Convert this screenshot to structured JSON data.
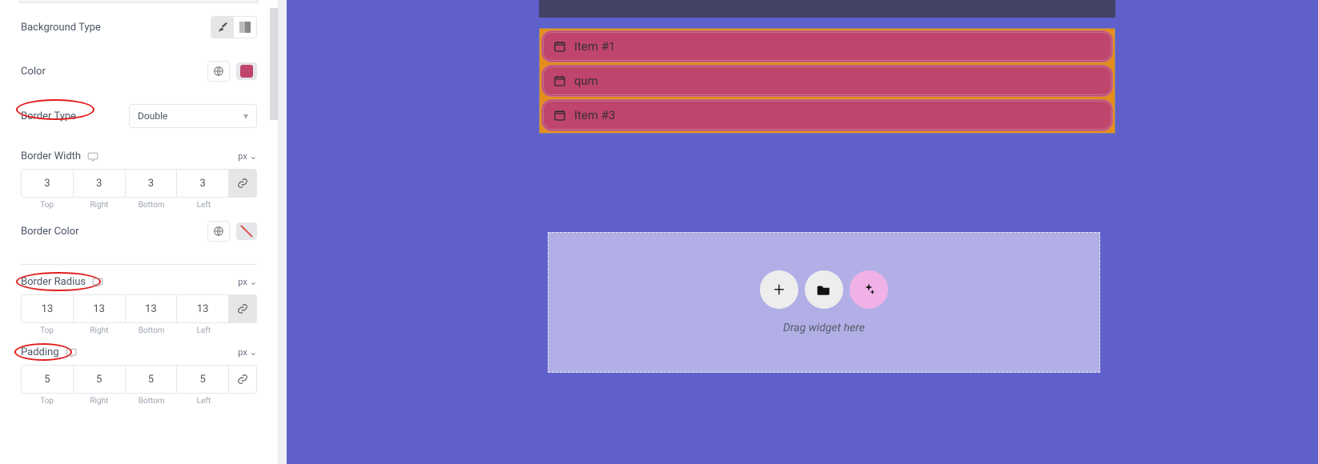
{
  "panel": {
    "background_type_label": "Background Type",
    "color_label": "Color",
    "color_swatch": "#c0456d",
    "border_type_label": "Border Type",
    "border_type_value": "Double",
    "border_width_label": "Border Width",
    "border_width_unit": "px",
    "border_width": {
      "top": "3",
      "right": "3",
      "bottom": "3",
      "left": "3"
    },
    "border_color_label": "Border Color",
    "border_radius_label": "Border Radius",
    "border_radius_unit": "px",
    "border_radius": {
      "top": "13",
      "right": "13",
      "bottom": "13",
      "left": "13"
    },
    "padding_label": "Padding",
    "padding_unit": "px",
    "padding": {
      "top": "5",
      "right": "5",
      "bottom": "5",
      "left": "5"
    },
    "captions": {
      "top": "Top",
      "right": "Right",
      "bottom": "Bottom",
      "left": "Left"
    }
  },
  "canvas": {
    "items": [
      {
        "label": "Item #1"
      },
      {
        "label": "qum"
      },
      {
        "label": "Item #3"
      }
    ],
    "drag_text": "Drag widget here"
  }
}
